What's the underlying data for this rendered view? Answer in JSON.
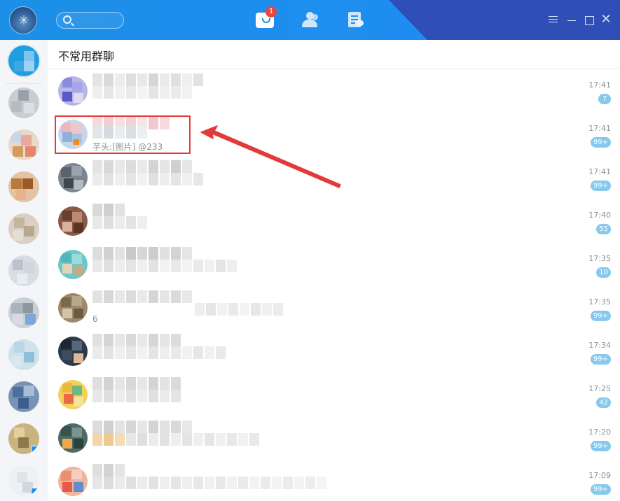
{
  "header": {
    "chat_badge": "1",
    "close_glyph": "✕",
    "icons": [
      "avatar-icon",
      "search-icon",
      "chat-icon",
      "contacts-icon",
      "docs-icon",
      "menu-icon",
      "minimize-icon",
      "maximize-icon",
      "close-icon"
    ]
  },
  "main": {
    "title": "不常用群聊"
  },
  "rows": [
    {
      "preview": "",
      "time": "17:41",
      "count": "7"
    },
    {
      "preview": "芋头:[图片] @233",
      "time": "17:41",
      "count": "99+"
    },
    {
      "preview": "",
      "time": "17:41",
      "count": "99+"
    },
    {
      "preview": "",
      "time": "17:40",
      "count": "55"
    },
    {
      "preview": "",
      "time": "17:35",
      "count": "10"
    },
    {
      "preview": "6",
      "time": "17:35",
      "count": "99+"
    },
    {
      "preview": "",
      "time": "17:34",
      "count": "99+"
    },
    {
      "preview": "",
      "time": "17:25",
      "count": "42"
    },
    {
      "preview": "",
      "time": "17:20",
      "count": "99+"
    },
    {
      "preview": "",
      "time": "17:09",
      "count": "99+"
    }
  ],
  "colors": {
    "topbar": "#1e8ef0",
    "topbar_dark": "#2f4fb7",
    "badge_red": "#e8473d",
    "count_bg": "#86c9ec",
    "highlight": "#e23b3b"
  }
}
